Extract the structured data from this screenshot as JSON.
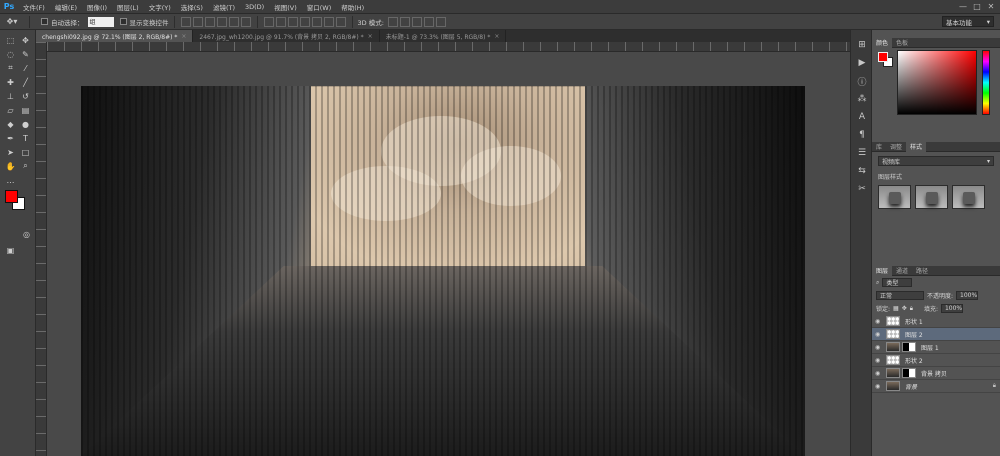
{
  "app": {
    "logo": "Ps"
  },
  "menu": [
    "文件(F)",
    "编辑(E)",
    "图像(I)",
    "图层(L)",
    "文字(Y)",
    "选择(S)",
    "滤镜(T)",
    "3D(D)",
    "视图(V)",
    "窗口(W)",
    "帮助(H)"
  ],
  "window_controls": {
    "minimize": "—",
    "maximize": "□",
    "close": "✕"
  },
  "options": {
    "auto_select_label": "自动选择：",
    "auto_select_value": "组",
    "show_transform_label": "显示变换控件",
    "mode_label": "3D 模式:",
    "workspace": "基本功能"
  },
  "tabs": [
    {
      "label": "chengshi092.jpg @ 72.1% (图层 2, RGB/8#) *",
      "active": true
    },
    {
      "label": "2467.jpg_wh1200.jpg @ 91.7% (背景 拷贝 2, RGB/8#) *",
      "active": false
    },
    {
      "label": "未标题-1 @ 73.3% (图层 5, RGB/8) *",
      "active": false
    }
  ],
  "panels": {
    "color": {
      "tabs": [
        "颜色",
        "色板"
      ]
    },
    "styles": {
      "tabs": [
        "库",
        "调整",
        "样式"
      ],
      "dropdown": "视频库",
      "preset_label": "图层样式"
    },
    "layers": {
      "tabs": [
        "图层",
        "通道",
        "路径"
      ],
      "filter_kind": "类型",
      "blend_mode": "正常",
      "opacity_label": "不透明度:",
      "opacity_value": "100%",
      "lock_label": "锁定:",
      "fill_label": "填充:",
      "fill_value": "100%",
      "rows": [
        {
          "name": "形状 1",
          "selected": false
        },
        {
          "name": "图层 2",
          "selected": true
        },
        {
          "name": "图层 1",
          "selected": false
        },
        {
          "name": "形状 2",
          "selected": false
        },
        {
          "name": "背景 拷贝",
          "selected": false
        },
        {
          "name": "背景",
          "selected": false
        }
      ]
    }
  },
  "colors": {
    "foreground": "#ff0000",
    "background": "#ffffff",
    "accent": "#5d6a7c"
  }
}
